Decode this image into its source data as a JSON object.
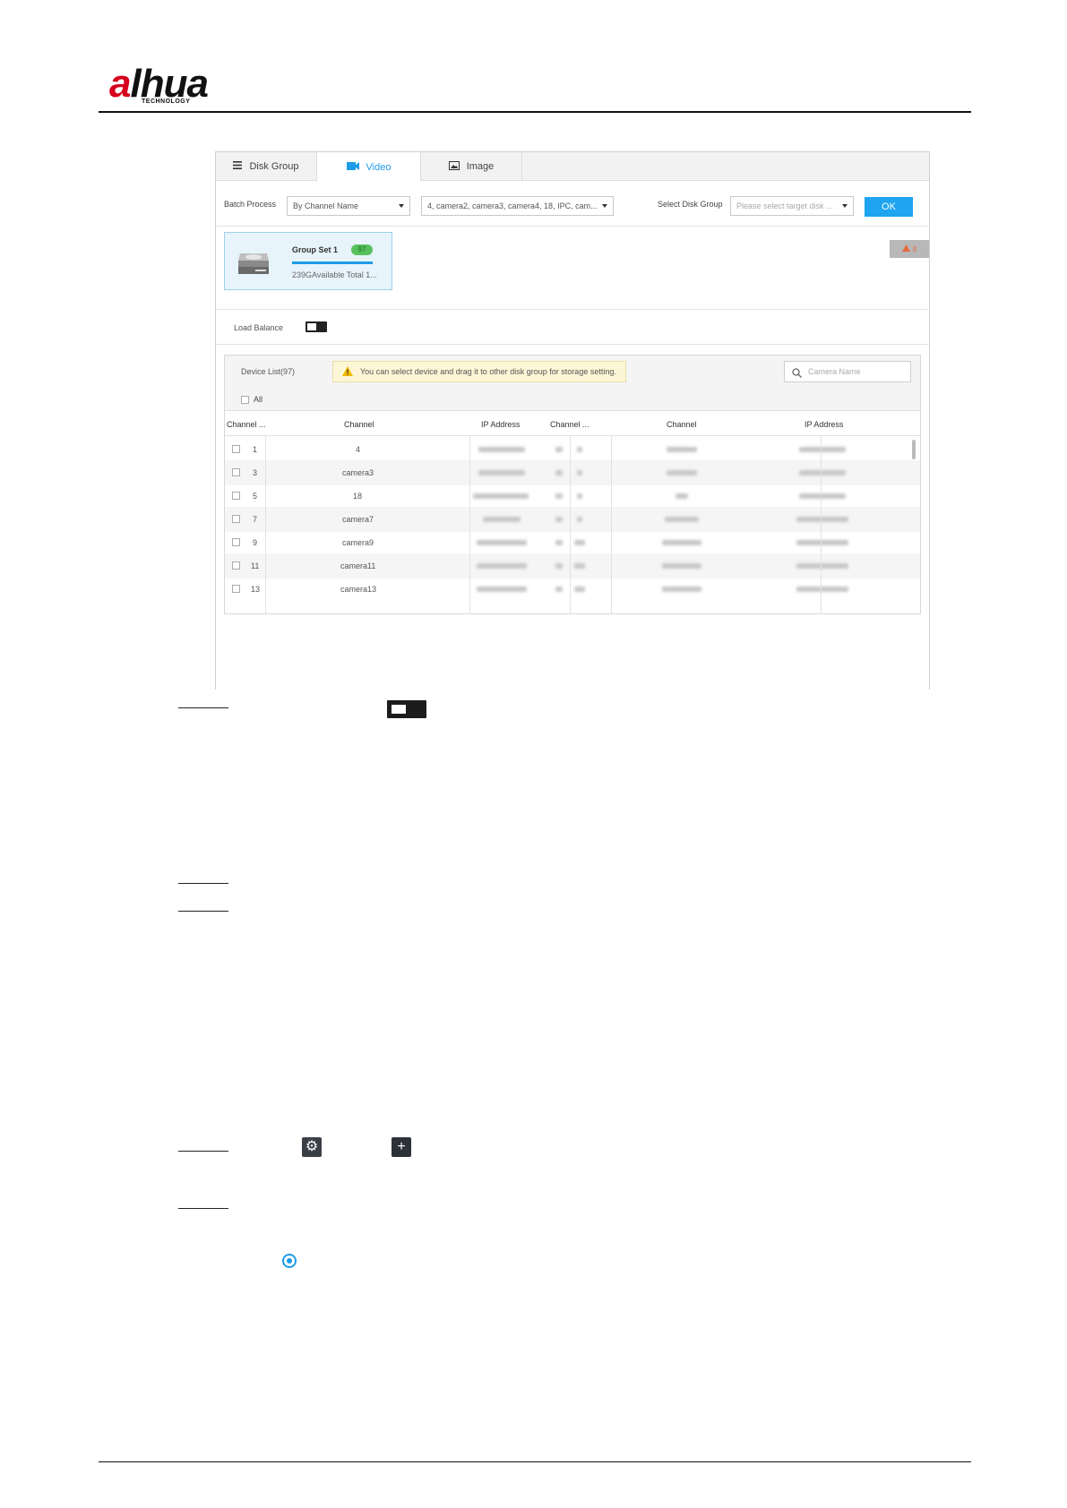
{
  "brand": {
    "logo_word": "alhua",
    "logo_sub": "TECHNOLOGY"
  },
  "tabs": [
    {
      "label": "Disk Group",
      "icon": "list-icon"
    },
    {
      "label": "Video",
      "icon": "video-camera-icon",
      "active": true
    },
    {
      "label": "Image",
      "icon": "image-icon"
    }
  ],
  "toolbar": {
    "batch_label": "Batch Process",
    "batch_mode": "By Channel Name",
    "channels_value": "4, camera2, camera3, camera4, 18, IPC, cam...",
    "select_group_label": "Select Disk Group",
    "select_group_placeholder": "Please select target disk ...",
    "ok_label": "OK"
  },
  "group": {
    "name": "Group Set 1",
    "count": "97",
    "info": "239GAvailable Total 1..."
  },
  "alarm": {
    "count": "8",
    "color": "#e66a3c"
  },
  "load_balance": {
    "label": "Load Balance"
  },
  "devices": {
    "title": "Device List(97)",
    "hint": "You can select device and drag it to other disk group for storage setting.",
    "search_placeholder": "Camera Name",
    "all_label": "All",
    "columns": [
      "Channel ...",
      "Channel",
      "IP Address",
      "Channel ...",
      "Channel",
      "IP Address"
    ],
    "rows": [
      {
        "no": "1",
        "channel": "4"
      },
      {
        "no": "3",
        "channel": "camera3"
      },
      {
        "no": "5",
        "channel": "18"
      },
      {
        "no": "7",
        "channel": "camera7"
      },
      {
        "no": "9",
        "channel": "camera9"
      },
      {
        "no": "11",
        "channel": "camera11"
      },
      {
        "no": "13",
        "channel": "camera13"
      }
    ]
  },
  "colors": {
    "accent": "#1e9be8",
    "ok_button": "#1ea4f0",
    "badge": "#56c15d"
  }
}
